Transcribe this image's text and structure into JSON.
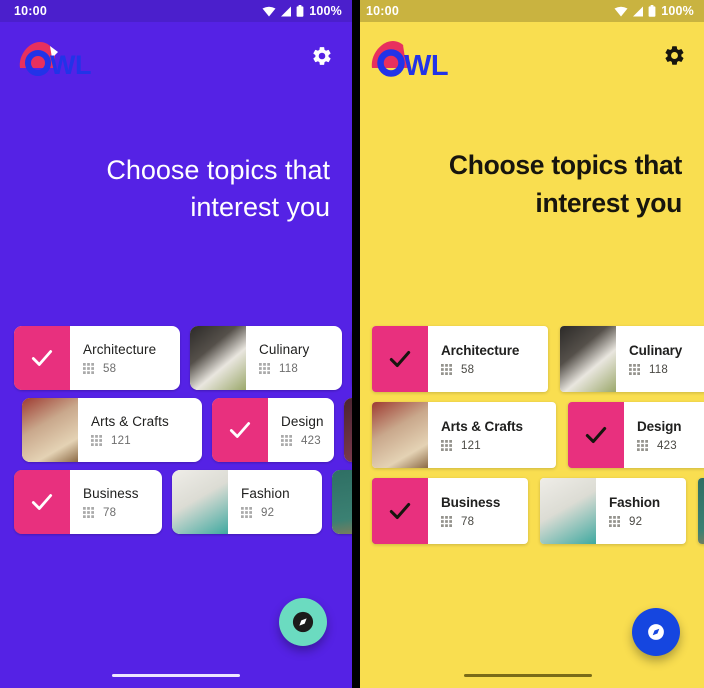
{
  "meta": {
    "app_name": "OWL",
    "screen": "topic-selection",
    "variants": [
      "purple-theme",
      "yellow-theme"
    ]
  },
  "colors": {
    "purple_background": "#5522E5",
    "purple_statusbar": "#4B1FCC",
    "yellow_background": "#F9DE50",
    "yellow_statusbar": "#C9B340",
    "selection_pink": "#E8307E",
    "logo_blue": "#2233E8",
    "logo_pink": "#E8305E",
    "fab_teal": "#6BDBC0",
    "fab_blue": "#1546E0",
    "card_white": "#FFFFFF",
    "text_dark": "#17150E",
    "text_white": "#FFFFFF",
    "meta_grey": "#6E6E6E"
  },
  "status_bar": {
    "time": "10:00",
    "battery_percent": "100%",
    "icons": [
      "wifi-icon",
      "cellular-signal-icon",
      "battery-icon"
    ]
  },
  "app_bar": {
    "logo_text": "OWL",
    "settings_label": "Settings",
    "settings_icon": "gear-icon"
  },
  "header": {
    "title_line1": "Choose topics that",
    "title_line2": "interest you"
  },
  "topics": {
    "count_icon": "grid-count-icon",
    "rows": [
      [
        {
          "name": "Architecture",
          "count": "58",
          "selected": true,
          "image": "architecture-building-thumb",
          "width_class": "w-arch"
        },
        {
          "name": "Culinary",
          "count": "118",
          "selected": false,
          "image": "culinary-chopping-thumb",
          "width_class": "w-culi"
        }
      ],
      [
        {
          "name": "Arts & Crafts",
          "count": "121",
          "selected": false,
          "image": "pottery-hands-thumb",
          "width_class": "w-arts"
        },
        {
          "name": "Design",
          "count": "423",
          "selected": true,
          "image": "design-tools-thumb",
          "width_class": "w-desi"
        }
      ],
      [
        {
          "name": "Business",
          "count": "78",
          "selected": true,
          "image": "business-suit-thumb",
          "width_class": "w-busi"
        },
        {
          "name": "Fashion",
          "count": "92",
          "selected": false,
          "image": "fashion-sewing-thumb",
          "width_class": "w-fash"
        }
      ]
    ],
    "peek_images": [
      "culinary-peek-thumb",
      "design-peek-thumb",
      "chalkboard-peek-thumb"
    ]
  },
  "fab": {
    "label": "Explore",
    "icon": "compass-icon"
  },
  "nav_bar": {
    "handle_label": "home-indicator"
  }
}
